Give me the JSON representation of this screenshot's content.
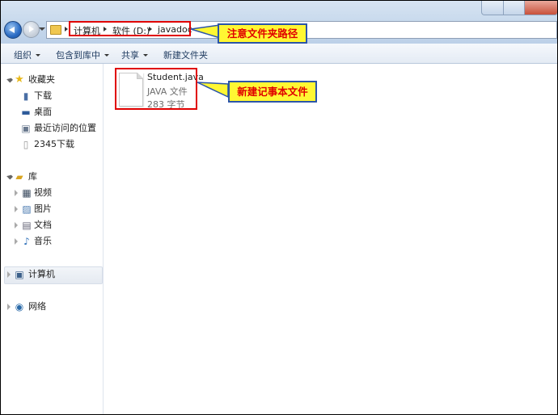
{
  "address": {
    "crumbs": [
      "计算机",
      "软件 (D:)",
      "javadoc"
    ]
  },
  "toolbar": {
    "organize": "组织",
    "include_library": "包含到库中",
    "share": "共享",
    "new_folder": "新建文件夹"
  },
  "sidebar": {
    "favorites": "收藏夹",
    "favorites_items": [
      "下载",
      "桌面",
      "最近访问的位置",
      "2345下载"
    ],
    "libraries": "库",
    "library_items": [
      "视频",
      "图片",
      "文档",
      "音乐"
    ],
    "computer": "计算机",
    "network": "网络"
  },
  "file": {
    "name": "Student.java",
    "type": "JAVA 文件",
    "size": "283 字节"
  },
  "annotations": {
    "path_note": "注意文件夹路径",
    "file_note": "新建记事本文件"
  },
  "colors": {
    "annotation_box": "#e00000",
    "callout_fill": "#fff733",
    "callout_border": "#2b55a8"
  }
}
